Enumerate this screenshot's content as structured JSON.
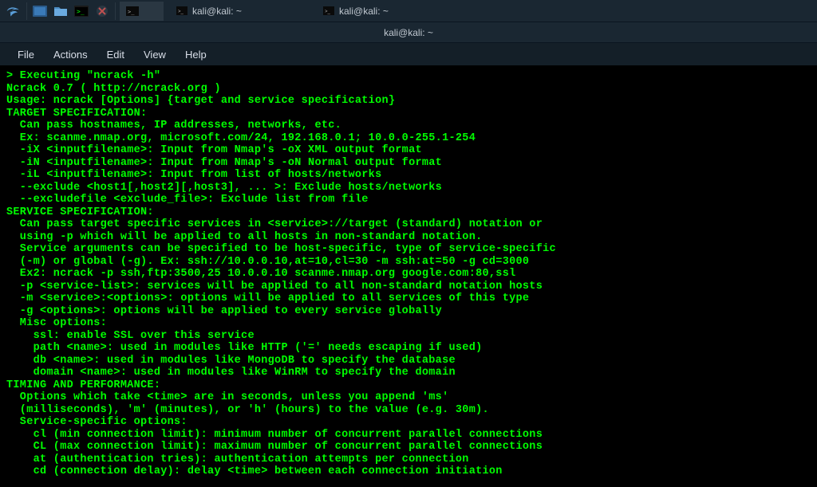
{
  "taskbar": {
    "tabs": [
      {
        "label": "kali@kali: ~"
      },
      {
        "label": "kali@kali: ~"
      }
    ]
  },
  "titlebar": {
    "title": "kali@kali: ~"
  },
  "menubar": {
    "file": "File",
    "actions": "Actions",
    "edit": "Edit",
    "view": "View",
    "help": "Help"
  },
  "terminal": {
    "lines": [
      "> Executing \"ncrack -h\"",
      "Ncrack 0.7 ( http://ncrack.org )",
      "Usage: ncrack [Options] {target and service specification}",
      "TARGET SPECIFICATION:",
      "  Can pass hostnames, IP addresses, networks, etc.",
      "  Ex: scanme.nmap.org, microsoft.com/24, 192.168.0.1; 10.0.0-255.1-254",
      "  -iX <inputfilename>: Input from Nmap's -oX XML output format",
      "  -iN <inputfilename>: Input from Nmap's -oN Normal output format",
      "  -iL <inputfilename>: Input from list of hosts/networks",
      "  --exclude <host1[,host2][,host3], ... >: Exclude hosts/networks",
      "  --excludefile <exclude_file>: Exclude list from file",
      "SERVICE SPECIFICATION:",
      "  Can pass target specific services in <service>://target (standard) notation or",
      "  using -p which will be applied to all hosts in non-standard notation.",
      "  Service arguments can be specified to be host-specific, type of service-specific",
      "  (-m) or global (-g). Ex: ssh://10.0.0.10,at=10,cl=30 -m ssh:at=50 -g cd=3000",
      "  Ex2: ncrack -p ssh,ftp:3500,25 10.0.0.10 scanme.nmap.org google.com:80,ssl",
      "  -p <service-list>: services will be applied to all non-standard notation hosts",
      "  -m <service>:<options>: options will be applied to all services of this type",
      "  -g <options>: options will be applied to every service globally",
      "  Misc options:",
      "    ssl: enable SSL over this service",
      "    path <name>: used in modules like HTTP ('=' needs escaping if used)",
      "    db <name>: used in modules like MongoDB to specify the database",
      "    domain <name>: used in modules like WinRM to specify the domain",
      "TIMING AND PERFORMANCE:",
      "  Options which take <time> are in seconds, unless you append 'ms'",
      "  (milliseconds), 'm' (minutes), or 'h' (hours) to the value (e.g. 30m).",
      "  Service-specific options:",
      "    cl (min connection limit): minimum number of concurrent parallel connections",
      "    CL (max connection limit): maximum number of concurrent parallel connections",
      "    at (authentication tries): authentication attempts per connection",
      "    cd (connection delay): delay <time> between each connection initiation"
    ]
  }
}
